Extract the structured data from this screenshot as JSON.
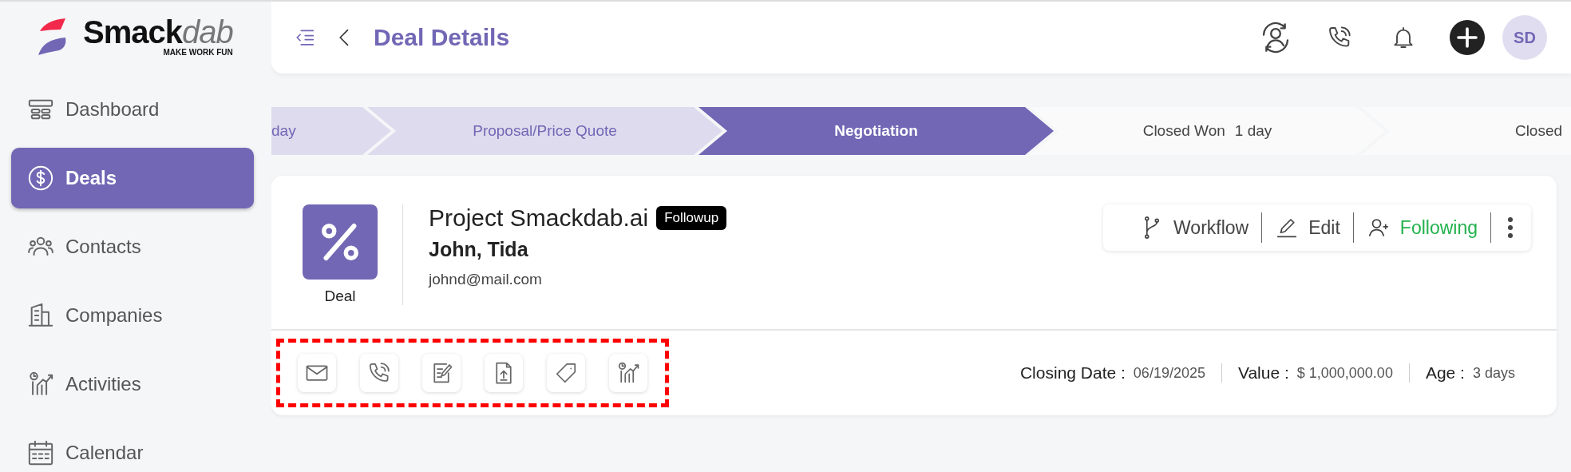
{
  "logo": {
    "name": "Smack",
    "name_accent": "dab",
    "tagline": "MAKE WORK FUN"
  },
  "sidebar": {
    "items": [
      {
        "kind": "dashboard",
        "label": "Dashboard",
        "selected": false
      },
      {
        "kind": "deals",
        "label": "Deals",
        "selected": true
      },
      {
        "kind": "contacts",
        "label": "Contacts",
        "selected": false
      },
      {
        "kind": "companies",
        "label": "Companies",
        "selected": false
      },
      {
        "kind": "activities",
        "label": "Activities",
        "selected": false
      },
      {
        "kind": "calendar",
        "label": "Calendar",
        "selected": false
      }
    ]
  },
  "header": {
    "title": "Deal Details",
    "actions": [
      {
        "kind": "sync-user"
      },
      {
        "kind": "phone"
      },
      {
        "kind": "bell"
      },
      {
        "kind": "add"
      }
    ],
    "avatar": "SD"
  },
  "pipeline": [
    {
      "label": "day",
      "completed": true,
      "selected": false
    },
    {
      "label": "Proposal/Price Quote",
      "completed": true,
      "selected": false
    },
    {
      "label": "Negotiation",
      "completed": false,
      "selected": true
    },
    {
      "label": "Closed Won",
      "duration": "1 day",
      "completed": false,
      "selected": false
    },
    {
      "label": "Closed",
      "completed": false,
      "selected": false
    }
  ],
  "deal": {
    "badge": "Deal",
    "title": "Project Smackdab.ai",
    "tag": "Followup",
    "contacts": "John, Tida",
    "email": "johnd@mail.com",
    "toolbar": [
      {
        "kind": "workflow",
        "label": "Workflow",
        "active": false
      },
      {
        "kind": "edit",
        "label": "Edit",
        "active": false
      },
      {
        "kind": "follow",
        "label": "Following",
        "active": true
      }
    ],
    "quick_actions": {
      "highlighted": true,
      "items": [
        {
          "kind": "email"
        },
        {
          "kind": "phone"
        },
        {
          "kind": "note"
        },
        {
          "kind": "upload"
        },
        {
          "kind": "tag"
        },
        {
          "kind": "activity"
        }
      ]
    },
    "facts": [
      {
        "label": "Closing Date :",
        "value": "06/19/2025"
      },
      {
        "label": "Value :",
        "value": "$ 1,000,000.00"
      },
      {
        "label": "Age :",
        "value": "3 days"
      }
    ]
  }
}
